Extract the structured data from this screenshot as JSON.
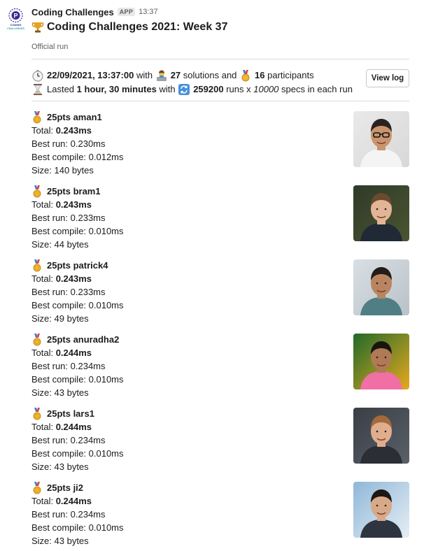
{
  "app": {
    "sender": "Coding Challenges",
    "badge": "APP",
    "time": "13:37",
    "icon": "coding-challenges-logo",
    "logo_text": "CODING CHALLENGES"
  },
  "message": {
    "title": "Coding Challenges 2021: Week 37",
    "title_icon": "trophy-icon",
    "subtitle": "Official run"
  },
  "summary": {
    "line1": {
      "datetime": "22/09/2021, 13:37:00",
      "with": "with",
      "solutions_count": "27",
      "solutions_label": "solutions and",
      "participants_count": "16",
      "participants_label": "participants"
    },
    "line2": {
      "lasted": "Lasted",
      "duration": "1 hour, 30 minutes",
      "with": "with",
      "runs": "259200",
      "runs_label": "runs x",
      "specs": "10000",
      "specs_label": "specs in each run"
    },
    "view_log_label": "View log"
  },
  "entries": [
    {
      "points": "25pts",
      "name": "aman1",
      "label": "25pts aman1",
      "total_label": "Total:",
      "total": "0.243ms",
      "best_run": "Best run: 0.230ms",
      "best_compile": "Best compile: 0.012ms",
      "size": "Size: 140 bytes"
    },
    {
      "points": "25pts",
      "name": "bram1",
      "label": "25pts bram1",
      "total_label": "Total:",
      "total": "0.243ms",
      "best_run": "Best run: 0.233ms",
      "best_compile": "Best compile: 0.010ms",
      "size": "Size: 44 bytes"
    },
    {
      "points": "25pts",
      "name": "patrick4",
      "label": "25pts patrick4",
      "total_label": "Total:",
      "total": "0.243ms",
      "best_run": "Best run: 0.233ms",
      "best_compile": "Best compile: 0.010ms",
      "size": "Size: 49 bytes"
    },
    {
      "points": "25pts",
      "name": "anuradha2",
      "label": "25pts anuradha2",
      "total_label": "Total:",
      "total": "0.244ms",
      "best_run": "Best run: 0.234ms",
      "best_compile": "Best compile: 0.010ms",
      "size": "Size: 43 bytes"
    },
    {
      "points": "25pts",
      "name": "lars1",
      "label": "25pts lars1",
      "total_label": "Total:",
      "total": "0.244ms",
      "best_run": "Best run: 0.234ms",
      "best_compile": "Best compile: 0.010ms",
      "size": "Size: 43 bytes"
    },
    {
      "points": "25pts",
      "name": "ji2",
      "label": "25pts ji2",
      "total_label": "Total:",
      "total": "0.244ms",
      "best_run": "Best run: 0.234ms",
      "best_compile": "Best compile: 0.010ms",
      "size": "Size: 43 bytes"
    }
  ],
  "icons": {
    "clock": "stopwatch-icon",
    "hourglass": "hourglass-icon",
    "technologist": "technologist-icon",
    "medal": "medal-icon",
    "repeat": "repeat-icon"
  },
  "colors": {
    "text": "#1d1c1d",
    "muted": "#616061",
    "divider": "#dcdcdc",
    "medal_gold": "#f2b632",
    "logo_purple": "#3b2a8c"
  }
}
